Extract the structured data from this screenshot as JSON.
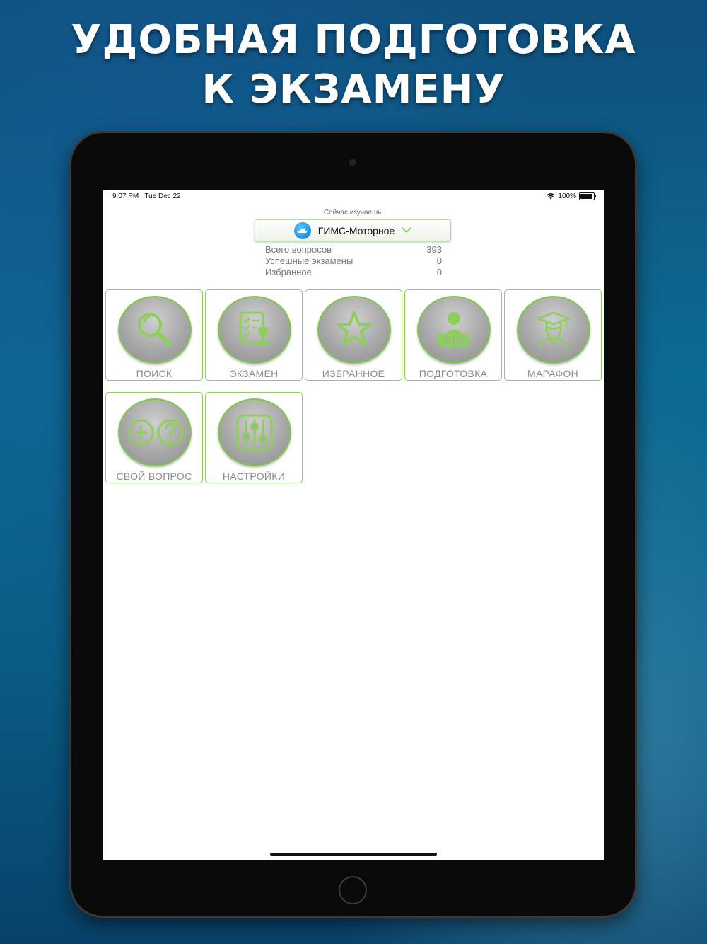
{
  "headline": {
    "line1": "УДОБНАЯ ПОДГОТОВКА",
    "line2": "К ЭКЗАМЕНУ"
  },
  "status_bar": {
    "time": "9:07 PM",
    "date": "Tue Dec 22",
    "battery": "100%"
  },
  "subject": {
    "caption": "Сейчас изучаешь:",
    "current": "ГИМС-Моторное",
    "icon": "boat-icon"
  },
  "stats": [
    {
      "label": "Всего вопросов",
      "value": "393"
    },
    {
      "label": "Успешные экзамены",
      "value": "0"
    },
    {
      "label": "Избранное",
      "value": "0"
    }
  ],
  "tiles": [
    {
      "label": "ПОИСК",
      "icon": "search-icon"
    },
    {
      "label": "ЭКЗАМЕН",
      "icon": "exam-checklist-icon"
    },
    {
      "label": "ИЗБРАННОЕ",
      "icon": "star-icon"
    },
    {
      "label": "ПОДГОТОВКА",
      "icon": "reading-person-icon"
    },
    {
      "label": "МАРАФОН",
      "icon": "graduate-icon"
    },
    {
      "label": "СВОЙ ВОПРОС",
      "icon": "add-question-icon"
    },
    {
      "label": "НАСТРОЙКИ",
      "icon": "sliders-icon"
    }
  ],
  "colors": {
    "accent_green": "#8ccf5a",
    "tile_gray": "#a8a8a8",
    "background_blue": "#0d6a93"
  }
}
